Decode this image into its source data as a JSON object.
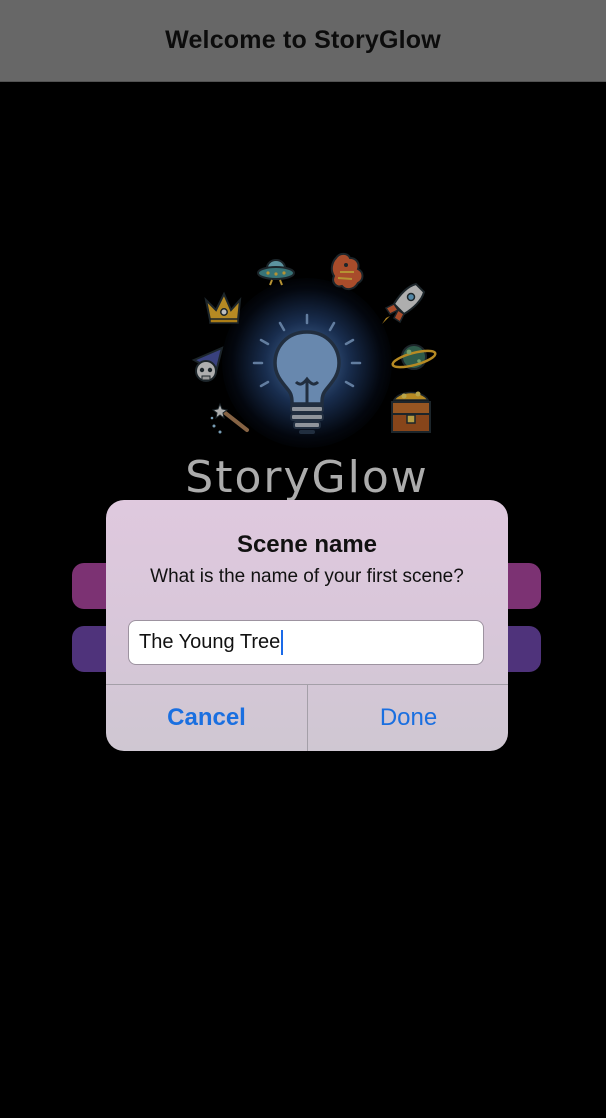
{
  "navbar": {
    "title": "Welcome to StoryGlow"
  },
  "logo": {
    "wordmark": "StoryGlow",
    "glow_color": "#6ea5eb"
  },
  "background_buttons": {
    "first_color": "#a6439a",
    "second_color": "#6a45a4"
  },
  "alert": {
    "title": "Scene name",
    "message": "What is the name of your first scene?",
    "input_value": "The Young Tree",
    "cancel_label": "Cancel",
    "done_label": "Done",
    "button_color": "#1a6fe0"
  },
  "icons": [
    "ufo-icon",
    "dragon-icon",
    "crown-icon",
    "rocket-icon",
    "wizard-skull-icon",
    "lightbulb-icon",
    "planet-icon",
    "magic-wand-icon",
    "treasure-chest-icon"
  ]
}
